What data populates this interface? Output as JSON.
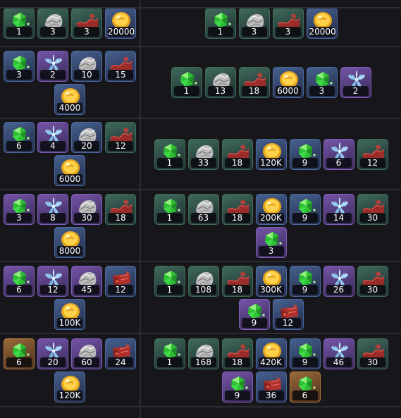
{
  "legend": {
    "green_gem": "green-gem-icon",
    "rock": "rock-icon",
    "red_cloth": "red-cloth-icon",
    "gold_coin": "gold-coin-icon",
    "blue_flower": "blue-flower-icon",
    "red_scroll": "red-scroll-icon"
  },
  "colors": {
    "rarity_green": "#3f6a5c",
    "rarity_blue": "#46618f",
    "rarity_purple": "#7654a8",
    "rarity_orange": "#9a6a3a",
    "quantity_text": "#ffffff",
    "background": "#17171b",
    "divider": "#2c2c33"
  },
  "rows": [
    {
      "left": [
        {
          "icon": "green_gem",
          "rarity": "green",
          "qty": "1"
        },
        {
          "icon": "rock",
          "rarity": "green",
          "qty": "3"
        },
        {
          "icon": "red_cloth",
          "rarity": "green",
          "qty": "3"
        },
        {
          "icon": "gold_coin",
          "rarity": "blue",
          "qty": "20000"
        }
      ],
      "right": [
        {
          "icon": "green_gem",
          "rarity": "green",
          "qty": "1"
        },
        {
          "icon": "rock",
          "rarity": "green",
          "qty": "3"
        },
        {
          "icon": "red_cloth",
          "rarity": "green",
          "qty": "3"
        },
        {
          "icon": "gold_coin",
          "rarity": "blue",
          "qty": "20000"
        }
      ]
    },
    {
      "left": [
        {
          "icon": "green_gem",
          "rarity": "blue",
          "qty": "3"
        },
        {
          "icon": "blue_flower",
          "rarity": "purple",
          "qty": "2"
        },
        {
          "icon": "rock",
          "rarity": "blue",
          "qty": "10"
        },
        {
          "icon": "red_cloth",
          "rarity": "blue",
          "qty": "15"
        },
        {
          "icon": "gold_coin",
          "rarity": "blue",
          "qty": "4000"
        }
      ],
      "right": [
        {
          "icon": "green_gem",
          "rarity": "green",
          "qty": "1"
        },
        {
          "icon": "rock",
          "rarity": "green",
          "qty": "13"
        },
        {
          "icon": "red_cloth",
          "rarity": "green",
          "qty": "18"
        },
        {
          "icon": "gold_coin",
          "rarity": "blue",
          "qty": "6000"
        },
        {
          "icon": "green_gem",
          "rarity": "blue",
          "qty": "3"
        },
        {
          "icon": "blue_flower",
          "rarity": "purple",
          "qty": "2"
        }
      ]
    },
    {
      "left": [
        {
          "icon": "green_gem",
          "rarity": "blue",
          "qty": "6"
        },
        {
          "icon": "blue_flower",
          "rarity": "purple",
          "qty": "4"
        },
        {
          "icon": "rock",
          "rarity": "blue",
          "qty": "20"
        },
        {
          "icon": "red_cloth",
          "rarity": "green",
          "qty": "12"
        },
        {
          "icon": "gold_coin",
          "rarity": "blue",
          "qty": "6000"
        }
      ],
      "right": [
        {
          "icon": "green_gem",
          "rarity": "green",
          "qty": "1"
        },
        {
          "icon": "rock",
          "rarity": "green",
          "qty": "33"
        },
        {
          "icon": "red_cloth",
          "rarity": "green",
          "qty": "18"
        },
        {
          "icon": "gold_coin",
          "rarity": "blue",
          "qty": "120K"
        },
        {
          "icon": "green_gem",
          "rarity": "blue",
          "qty": "9"
        },
        {
          "icon": "blue_flower",
          "rarity": "purple",
          "qty": "6"
        },
        {
          "icon": "red_cloth",
          "rarity": "green",
          "qty": "12"
        }
      ]
    },
    {
      "left": [
        {
          "icon": "green_gem",
          "rarity": "purple",
          "qty": "3"
        },
        {
          "icon": "blue_flower",
          "rarity": "purple",
          "qty": "8"
        },
        {
          "icon": "rock",
          "rarity": "purple",
          "qty": "30"
        },
        {
          "icon": "red_cloth",
          "rarity": "green",
          "qty": "18"
        },
        {
          "icon": "gold_coin",
          "rarity": "blue",
          "qty": "8000"
        }
      ],
      "right": [
        {
          "icon": "green_gem",
          "rarity": "green",
          "qty": "1"
        },
        {
          "icon": "rock",
          "rarity": "green",
          "qty": "63"
        },
        {
          "icon": "red_cloth",
          "rarity": "green",
          "qty": "18"
        },
        {
          "icon": "gold_coin",
          "rarity": "blue",
          "qty": "200K"
        },
        {
          "icon": "green_gem",
          "rarity": "blue",
          "qty": "9"
        },
        {
          "icon": "blue_flower",
          "rarity": "purple",
          "qty": "14"
        },
        {
          "icon": "red_cloth",
          "rarity": "green",
          "qty": "30"
        },
        {
          "icon": "green_gem",
          "rarity": "purple",
          "qty": "3"
        }
      ]
    },
    {
      "left": [
        {
          "icon": "green_gem",
          "rarity": "purple",
          "qty": "6"
        },
        {
          "icon": "blue_flower",
          "rarity": "purple",
          "qty": "12"
        },
        {
          "icon": "rock",
          "rarity": "purple",
          "qty": "45"
        },
        {
          "icon": "red_scroll",
          "rarity": "blue",
          "qty": "12"
        },
        {
          "icon": "gold_coin",
          "rarity": "blue",
          "qty": "100K"
        }
      ],
      "right": [
        {
          "icon": "green_gem",
          "rarity": "green",
          "qty": "1"
        },
        {
          "icon": "rock",
          "rarity": "green",
          "qty": "108"
        },
        {
          "icon": "red_cloth",
          "rarity": "green",
          "qty": "18"
        },
        {
          "icon": "gold_coin",
          "rarity": "blue",
          "qty": "300K"
        },
        {
          "icon": "green_gem",
          "rarity": "blue",
          "qty": "9"
        },
        {
          "icon": "blue_flower",
          "rarity": "purple",
          "qty": "26"
        },
        {
          "icon": "red_cloth",
          "rarity": "green",
          "qty": "30"
        },
        {
          "icon": "green_gem",
          "rarity": "purple",
          "qty": "9"
        },
        {
          "icon": "red_scroll",
          "rarity": "blue",
          "qty": "12"
        }
      ]
    },
    {
      "left": [
        {
          "icon": "green_gem",
          "rarity": "orange",
          "qty": "6"
        },
        {
          "icon": "blue_flower",
          "rarity": "purple",
          "qty": "20"
        },
        {
          "icon": "rock",
          "rarity": "purple",
          "qty": "60"
        },
        {
          "icon": "red_scroll",
          "rarity": "blue",
          "qty": "24"
        },
        {
          "icon": "gold_coin",
          "rarity": "blue",
          "qty": "120K"
        }
      ],
      "right": [
        {
          "icon": "green_gem",
          "rarity": "green",
          "qty": "1"
        },
        {
          "icon": "rock",
          "rarity": "green",
          "qty": "168"
        },
        {
          "icon": "red_cloth",
          "rarity": "green",
          "qty": "18"
        },
        {
          "icon": "gold_coin",
          "rarity": "blue",
          "qty": "420K"
        },
        {
          "icon": "green_gem",
          "rarity": "blue",
          "qty": "9"
        },
        {
          "icon": "blue_flower",
          "rarity": "purple",
          "qty": "46"
        },
        {
          "icon": "red_cloth",
          "rarity": "green",
          "qty": "30"
        },
        {
          "icon": "green_gem",
          "rarity": "purple",
          "qty": "9"
        },
        {
          "icon": "red_scroll",
          "rarity": "blue",
          "qty": "36"
        },
        {
          "icon": "green_gem",
          "rarity": "orange",
          "qty": "6"
        }
      ]
    }
  ]
}
